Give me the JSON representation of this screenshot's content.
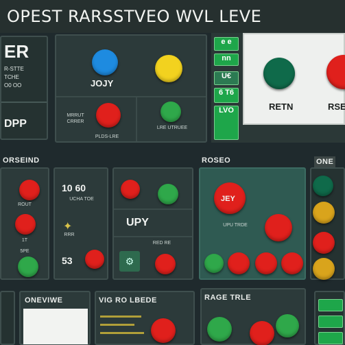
{
  "title": "OPEST RARSSTVEO WVL LEVE",
  "left_panel": {
    "heading": "ER",
    "lines": [
      "R-STTE",
      "TCHE",
      "O0 OO"
    ],
    "footer": "DPP"
  },
  "top_center": {
    "mid_label": "JOJY",
    "caption_left": "MRRUT CRRER",
    "caption_bottom": "PLDS-LRE",
    "caption_right": "LRE UTRUEE"
  },
  "right_top": {
    "tabs": [
      "e e",
      "nn",
      "U€",
      "6 T6",
      "LVO"
    ],
    "label_left": "RETN",
    "label_right": "RSE"
  },
  "sections": {
    "left": "ORSEIND",
    "center": "ROSEO",
    "right": "ONE"
  },
  "mid_left": {
    "rows": [
      "ROUT",
      "1T",
      "5PE"
    ]
  },
  "mid_center": {
    "num": "10 60",
    "sub": "UCHA TOE",
    "icon_label": "RRR",
    "bottom": "53"
  },
  "mid_right_small": {
    "heading": "UPY",
    "label": "RED RE"
  },
  "teal_panel": {
    "label": "JEY",
    "caption": "UPU TRDE"
  },
  "bottom": {
    "left_label": "ONEVIWE",
    "center_label": "VIG RO LBEDE",
    "right_label": "RAGE TRLE"
  },
  "colors": {
    "red": "#e0201c",
    "blue": "#1e8be0",
    "yellow": "#f2d21f",
    "green": "#2fa84a",
    "teal": "#2f5a52"
  }
}
